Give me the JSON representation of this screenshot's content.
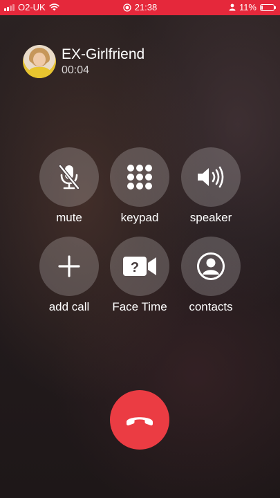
{
  "status_bar": {
    "carrier": "O2-UK",
    "time": "21:38",
    "battery_text": "11%",
    "battery_level": 0.11,
    "background_color": "#e5283b",
    "icons": [
      "signal-icon",
      "wifi-icon",
      "screen-recording-icon",
      "person-icon",
      "battery-icon"
    ]
  },
  "caller": {
    "name": "EX-Girlfriend",
    "duration": "00:04"
  },
  "controls": [
    {
      "id": "mute",
      "label": "mute",
      "icon": "microphone-slash-icon"
    },
    {
      "id": "keypad",
      "label": "keypad",
      "icon": "keypad-icon"
    },
    {
      "id": "speaker",
      "label": "speaker",
      "icon": "speaker-icon"
    },
    {
      "id": "add_call",
      "label": "add call",
      "icon": "plus-icon"
    },
    {
      "id": "facetime",
      "label": "Face Time",
      "icon": "facetime-video-icon"
    },
    {
      "id": "contacts",
      "label": "contacts",
      "icon": "contact-icon"
    }
  ],
  "end_call": {
    "icon": "phone-hangup-icon",
    "color": "#eb3c43"
  }
}
